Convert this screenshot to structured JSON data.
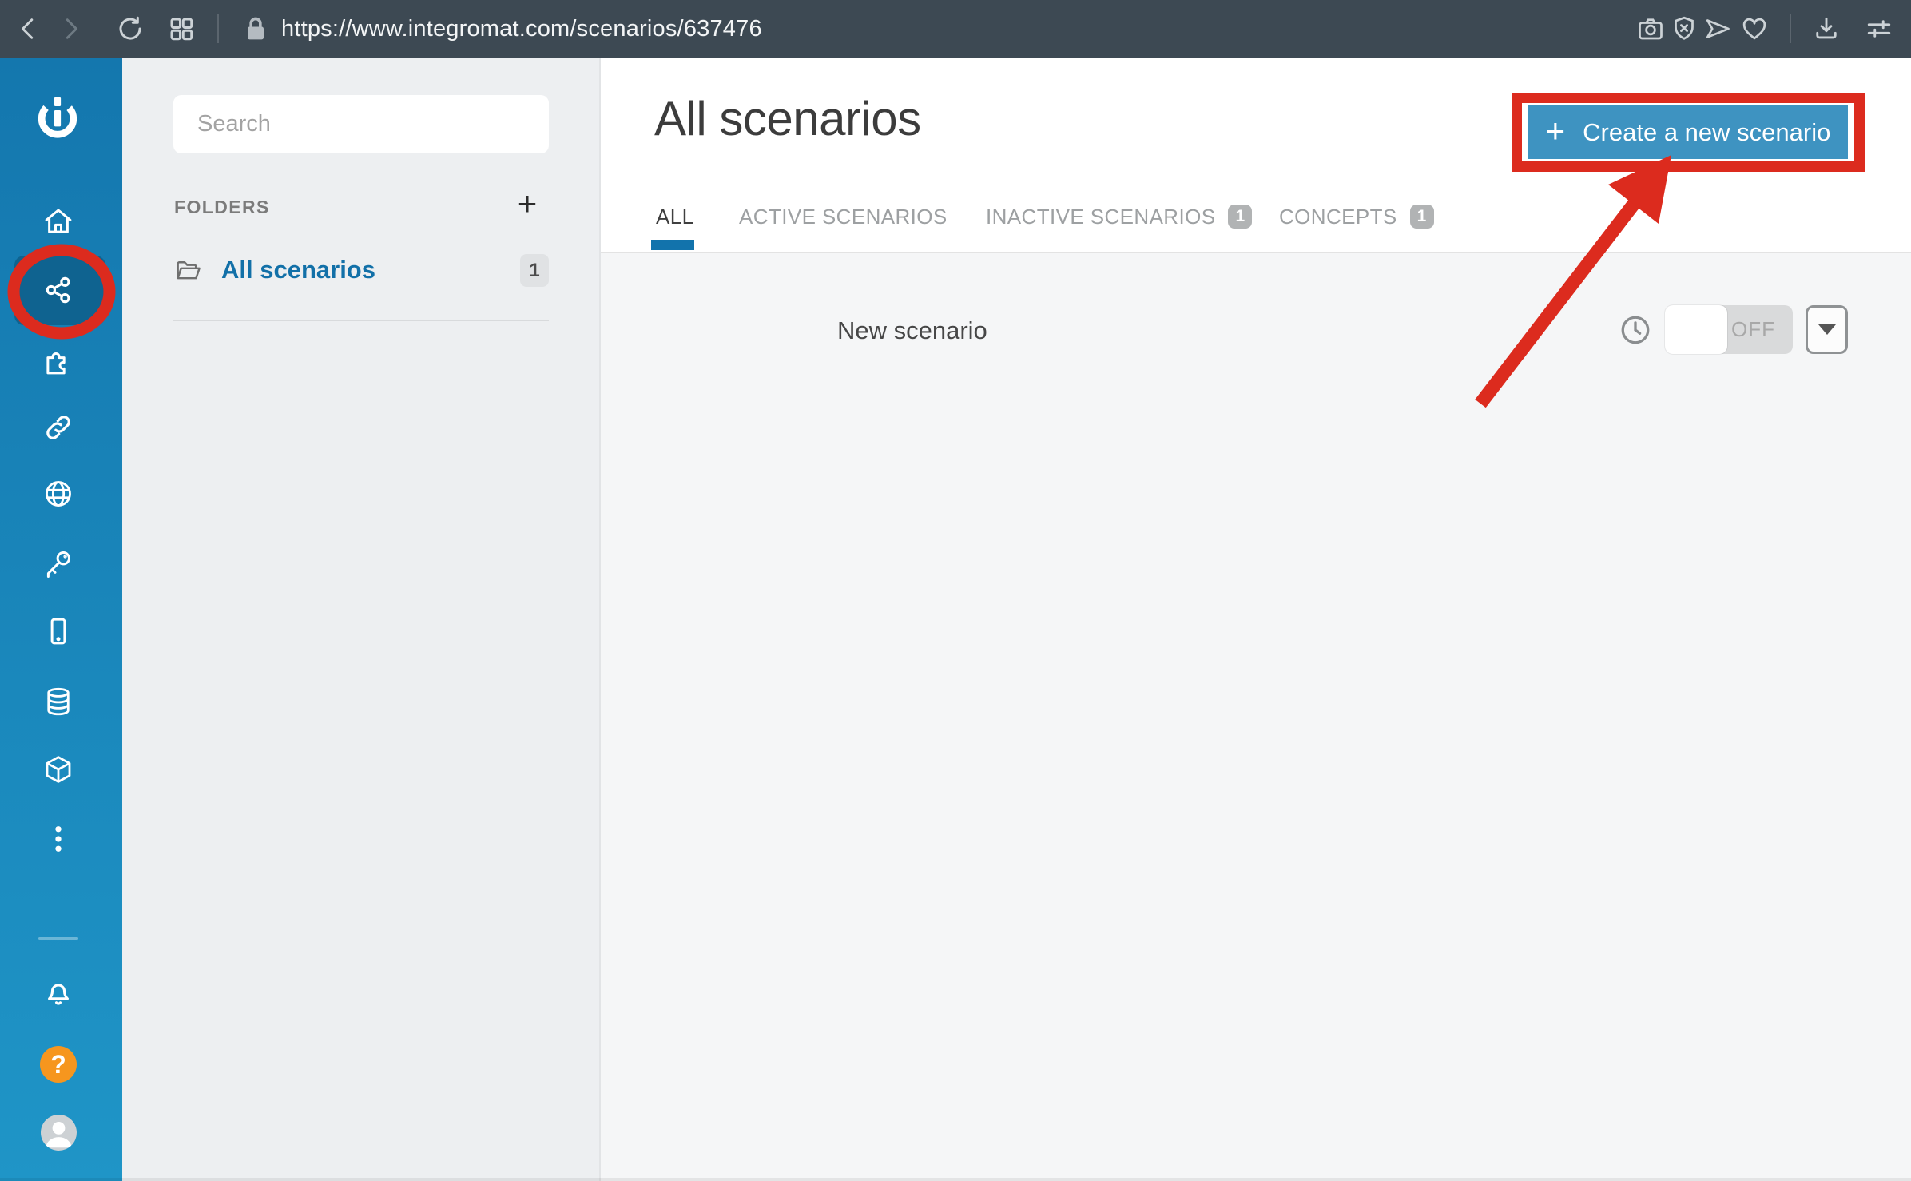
{
  "browser": {
    "url": "https://www.integromat.com/scenarios/637476"
  },
  "folders_panel": {
    "search_placeholder": "Search",
    "heading": "FOLDERS",
    "add_label": "+",
    "items": [
      {
        "label": "All scenarios",
        "count": "1"
      }
    ]
  },
  "sidebar": {
    "help_label": "?"
  },
  "main": {
    "title": "All scenarios",
    "create_button": {
      "plus": "+",
      "label": "Create a new scenario"
    },
    "tabs": [
      {
        "label": "ALL"
      },
      {
        "label": "ACTIVE SCENARIOS"
      },
      {
        "label": "INACTIVE SCENARIOS",
        "badge": "1"
      },
      {
        "label": "CONCEPTS",
        "badge": "1"
      }
    ],
    "row": {
      "name": "New scenario",
      "toggle": "OFF"
    }
  },
  "colors": {
    "sidebar_blue_top": "#1477ae",
    "sidebar_blue_bottom": "#1f95c7",
    "active_item_bg": "#0f6390",
    "accent_blue": "#1273ac",
    "button_blue": "#3e93c1",
    "annotation_red": "#dc2b1e",
    "help_orange": "#f6961e",
    "toolbar_dark": "#3d4953"
  }
}
